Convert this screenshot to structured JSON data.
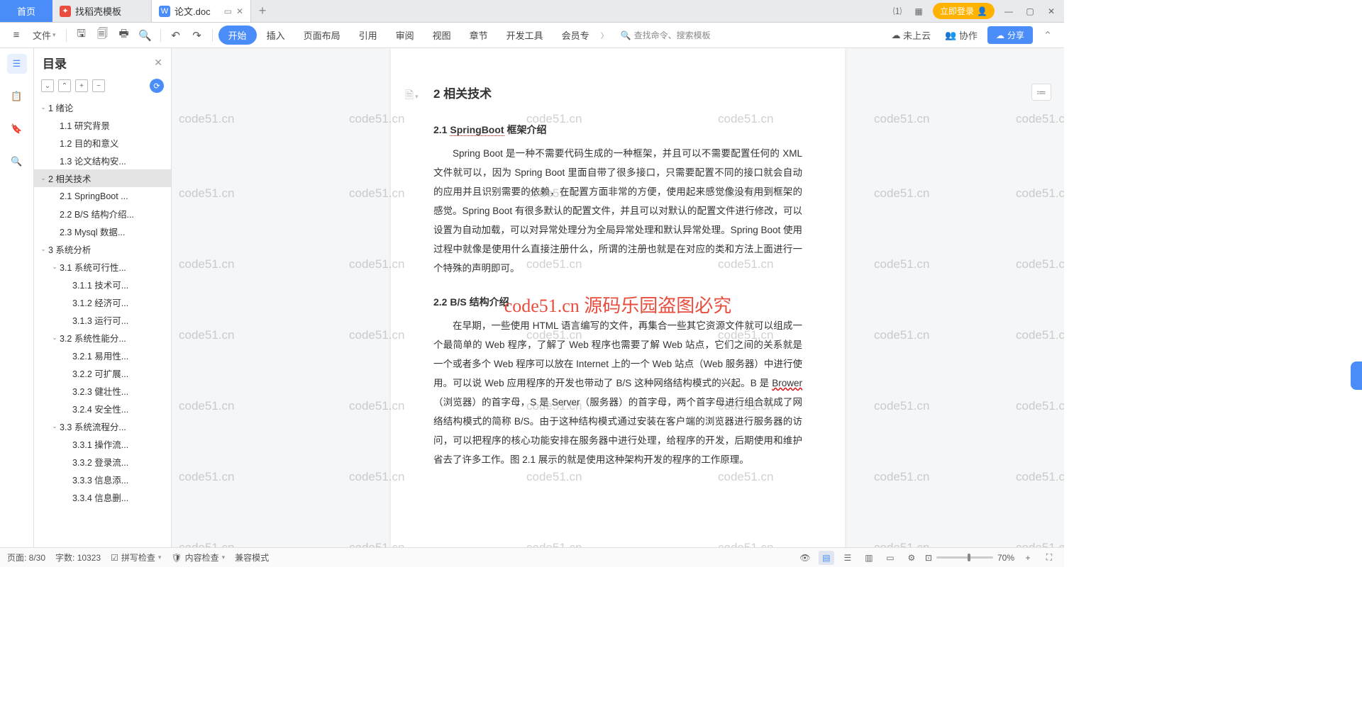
{
  "tabs": {
    "home": "首页",
    "t1": "找稻壳模板",
    "t2": "论文.doc"
  },
  "login": "立即登录",
  "ribbon": {
    "file": "文件",
    "tabs": [
      "开始",
      "插入",
      "页面布局",
      "引用",
      "审阅",
      "视图",
      "章节",
      "开发工具",
      "会员专"
    ],
    "search": "查找命令、搜索模板",
    "cloud": "未上云",
    "collab": "协作",
    "share": "分享"
  },
  "outline": {
    "title": "目录",
    "items": [
      {
        "d": 1,
        "caret": 1,
        "label": "1  绪论"
      },
      {
        "d": 2,
        "caret": 0,
        "label": "1.1  研究背景"
      },
      {
        "d": 2,
        "caret": 0,
        "label": "1.2  目的和意义"
      },
      {
        "d": 2,
        "caret": 0,
        "label": "1.3  论文结构安..."
      },
      {
        "d": 1,
        "caret": 1,
        "label": "2  相关技术",
        "sel": 1
      },
      {
        "d": 2,
        "caret": 0,
        "label": "2.1  SpringBoot ..."
      },
      {
        "d": 2,
        "caret": 0,
        "label": "2.2  B/S 结构介绍..."
      },
      {
        "d": 2,
        "caret": 0,
        "label": "2.3  Mysql 数据..."
      },
      {
        "d": 1,
        "caret": 1,
        "label": "3  系统分析"
      },
      {
        "d": 2,
        "caret": 1,
        "label": "3.1  系统可行性..."
      },
      {
        "d": 3,
        "caret": 0,
        "label": "3.1.1  技术可..."
      },
      {
        "d": 3,
        "caret": 0,
        "label": "3.1.2  经济可..."
      },
      {
        "d": 3,
        "caret": 0,
        "label": "3.1.3  运行可..."
      },
      {
        "d": 2,
        "caret": 1,
        "label": "3.2  系统性能分..."
      },
      {
        "d": 3,
        "caret": 0,
        "label": "3.2.1  易用性..."
      },
      {
        "d": 3,
        "caret": 0,
        "label": "3.2.2  可扩展..."
      },
      {
        "d": 3,
        "caret": 0,
        "label": "3.2.3  健壮性..."
      },
      {
        "d": 3,
        "caret": 0,
        "label": "3.2.4  安全性..."
      },
      {
        "d": 2,
        "caret": 1,
        "label": "3.3  系统流程分..."
      },
      {
        "d": 3,
        "caret": 0,
        "label": "3.3.1  操作流..."
      },
      {
        "d": 3,
        "caret": 0,
        "label": "3.3.2  登录流..."
      },
      {
        "d": 3,
        "caret": 0,
        "label": "3.3.3  信息添..."
      },
      {
        "d": 3,
        "caret": 0,
        "label": "3.3.4  信息删..."
      }
    ]
  },
  "doc": {
    "h1": "2  相关技术",
    "h2a_pre": "2.1 ",
    "h2a_u": "SpringBoot",
    "h2a_post": " 框架介绍",
    "p1": "Spring Boot 是一种不需要代码生成的一种框架，并且可以不需要配置任何的 XML 文件就可以，因为 Spring Boot 里面自带了很多接口，只需要配置不同的接口就会自动的应用并且识别需要的依赖，在配置方面非常的方便，使用起来感觉像没有用到框架的感觉。Spring Boot 有很多默认的配置文件，并且可以对默认的配置文件进行修改，可以设置为自动加载，可以对异常处理分为全局异常处理和默认异常处理。Spring Boot 使用过程中就像是使用什么直接注册什么，所谓的注册也就是在对应的类和方法上面进行一个特殊的声明即可。",
    "h2b": "2.2 B/S 结构介绍",
    "p2a": "在早期，一些使用 HTML 语言编写的文件，再集合一些其它资源文件就可以组成一个最简单的 Web 程序，了解了 Web 程序也需要了解 Web 站点，它们之间的关系就是一个或者多个 Web 程序可以放在 Internet 上的一个 Web 站点（Web 服务器）中进行使用。可以说 Web 应用程序的开发也带动了 B/S 这种网络结构模式的兴起。B 是 ",
    "p2w": "Brower",
    "p2b": "（浏览器）的首字母，S 是 Server（服务器）的首字母，两个首字母进行组合就成了网络结构模式的简称 B/S。由于这种结构模式通过安装在客户端的浏览器进行服务器的访问，可以把程序的核心功能安排在服务器中进行处理，给程序的开发，后期使用和维护省去了许多工作。图 2.1 展示的就是使用这种架构开发的程序的工作原理。"
  },
  "watermark": {
    "text": "code51.cn",
    "red": "code51.cn 源码乐园盗图必究"
  },
  "status": {
    "page": "页面: 8/30",
    "words": "字数: 10323",
    "spell": "拼写检查",
    "content": "内容检查",
    "compat": "兼容模式",
    "zoom": "70%"
  }
}
